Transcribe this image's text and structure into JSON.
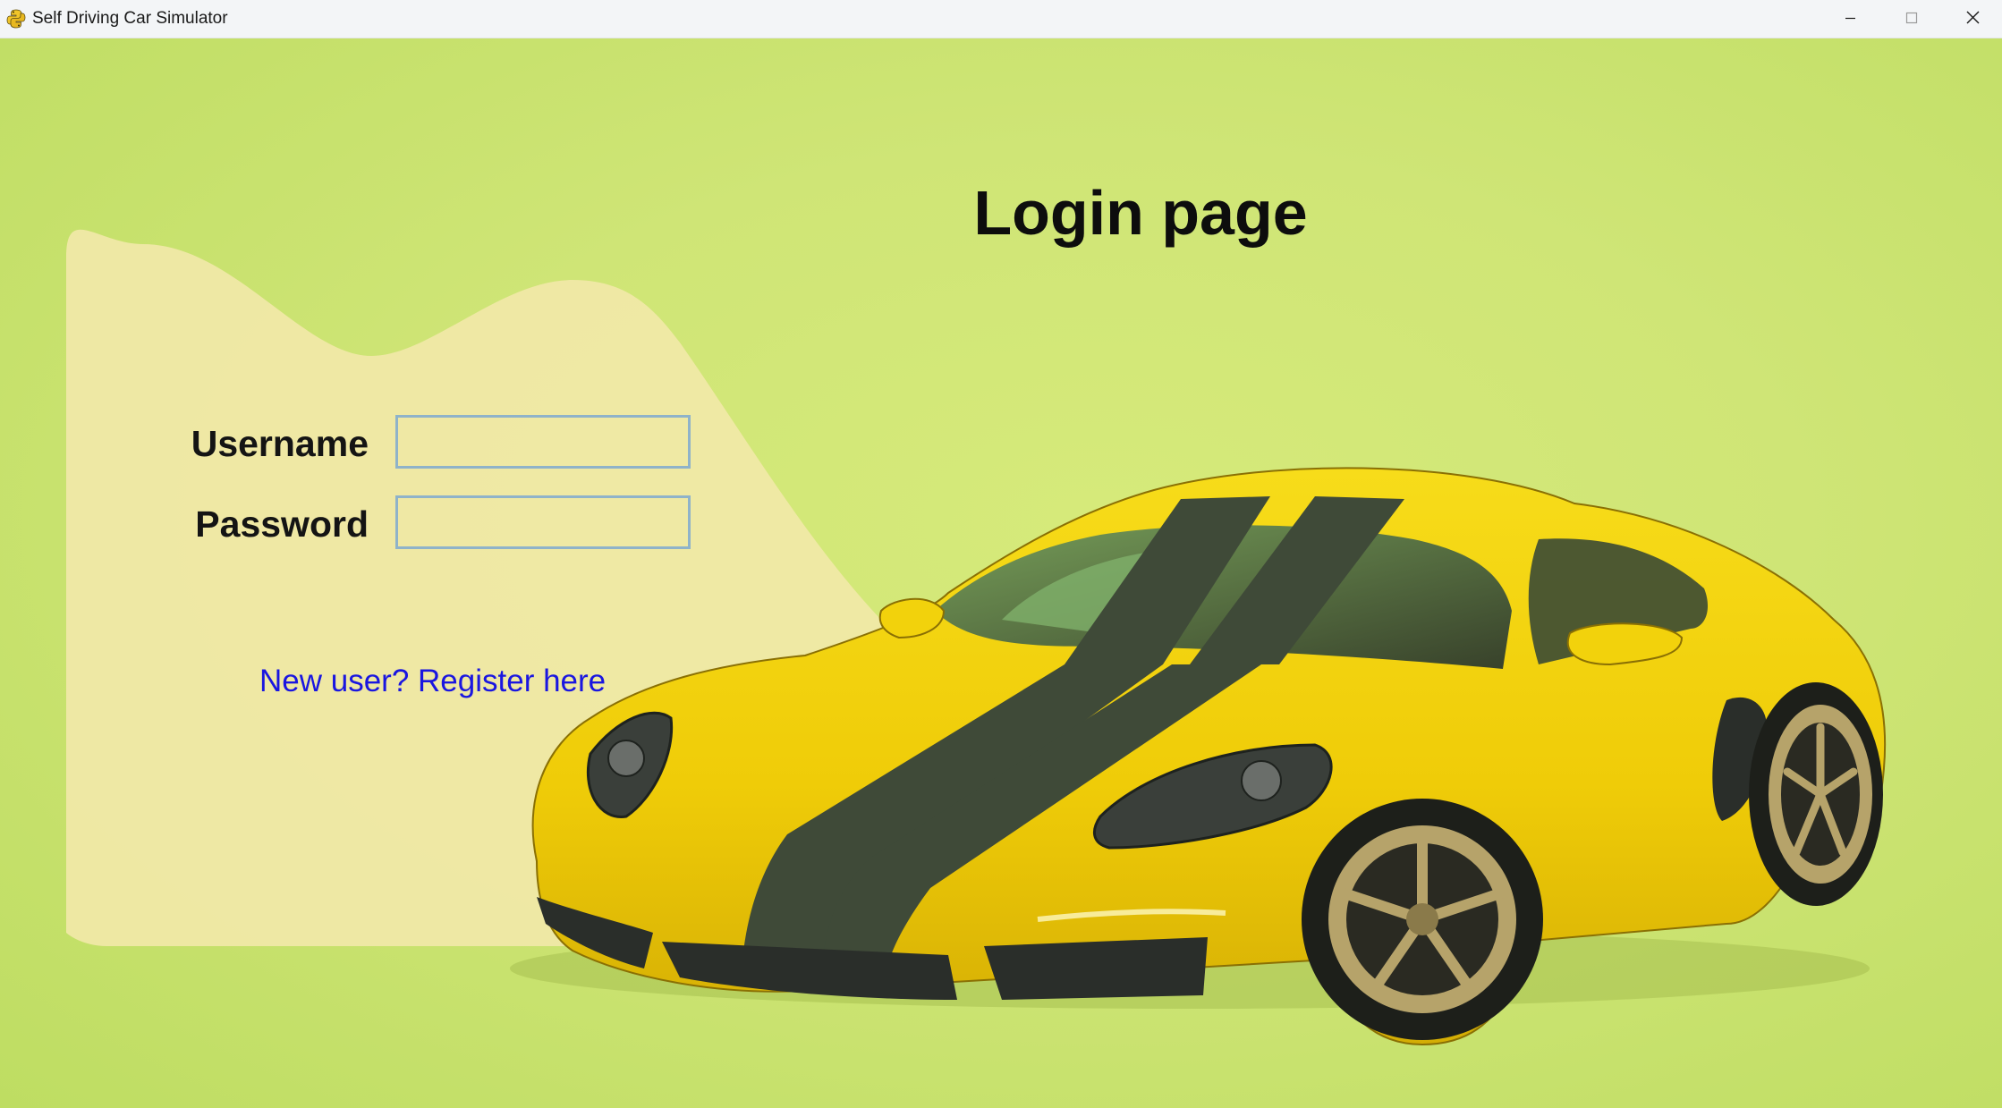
{
  "window": {
    "title": "Self Driving Car Simulator",
    "app_icon": "python-icon",
    "controls": {
      "minimize_icon": "minimize-icon",
      "maximize_icon": "maximize-icon",
      "close_icon": "close-icon"
    }
  },
  "page": {
    "title": "Login page"
  },
  "form": {
    "username_label": "Username",
    "username_value": "",
    "password_label": "Password",
    "password_value": ""
  },
  "register_link": "New user? Register here",
  "colors": {
    "background": "#cfe576",
    "panel": "#f1e8a8",
    "car_body": "#f2d20c",
    "stripe": "#3f4a38",
    "link": "#1a16e0",
    "input_border": "#8fb3c9"
  }
}
